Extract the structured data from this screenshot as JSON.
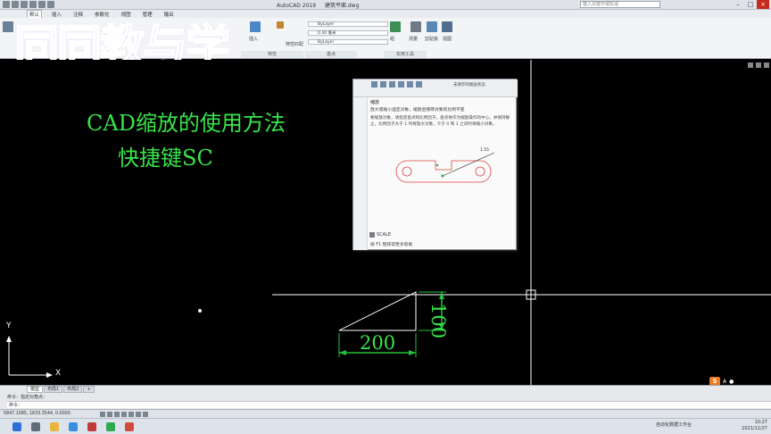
{
  "titlebar": {
    "app_title": "AutoCAD 2019",
    "doc_title": "建筑平面.dwg",
    "search_placeholder": "键入关键字或短语",
    "close": "×",
    "minimize": "–",
    "maximize": "□"
  },
  "ribbon_tabs": [
    "默认",
    "插入",
    "注释",
    "参数化",
    "视图",
    "管理",
    "输出"
  ],
  "ribbon": {
    "bylayer_1": "ByLayer",
    "lineweight": "0.30 毫米",
    "bylayer_2": "ByLayer",
    "insert_label": "插入",
    "match_prop": "特性匹配",
    "props_panel": "特性",
    "utilities_panel": "实用工具",
    "clipboard": "剪贴板",
    "view_panel": "视图",
    "measure": "测量",
    "group": "组",
    "base": "基点"
  },
  "watermark": "同同教与学",
  "canvas": {
    "heading_1": "CAD缩放的使用方法",
    "heading_2": "快捷键SC",
    "dim_horizontal": "200",
    "dim_vertical": "100",
    "axis_x": "X",
    "axis_y": "Y"
  },
  "tooltip": {
    "toolbar_text": "未保存的图层状态",
    "command_name": "缩放",
    "description": "放大或缩小选定对象，缩放后保持对象的比例不变",
    "detail": "要缩放对象，请指定基点和比例因子。基点将作为缩放操作的中心，并保持静止。比例因子大于 1 时将放大对象，介于 0 和 1 之间时将缩小对象。",
    "figure_label": "1.55",
    "command": "SCALE",
    "help": "按 F1 键获得更多帮助"
  },
  "command_area": {
    "tabs": [
      "模型",
      "布局1",
      "布局2",
      "+"
    ],
    "history_line": "命令：指定对角点：",
    "prompt": "命令："
  },
  "statusbar": {
    "coords": "5847.1085, 1633.3544, 0.0000",
    "model_label": "模型"
  },
  "taskbar": {
    "tray_text": "自动化数据工作台",
    "time": "10:27",
    "date": "2021/11/27"
  },
  "colors": {
    "cad_green": "#39e44a",
    "watermark_fill": "#cf6cf2",
    "dim_green": "#22c23a"
  }
}
